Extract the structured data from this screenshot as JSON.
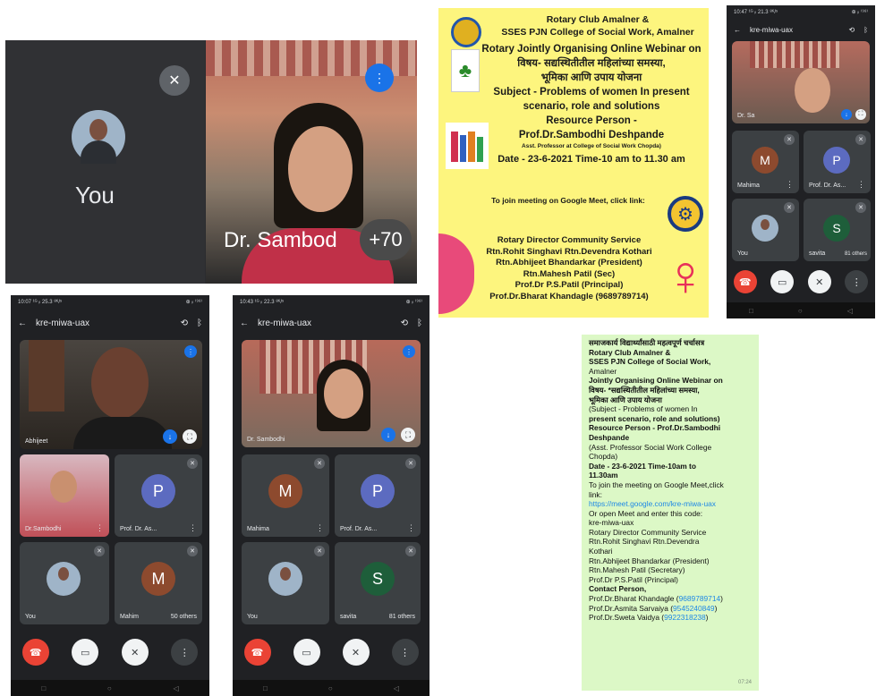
{
  "call_top_left": {
    "self_label": "You",
    "speaker_name": "Dr. Sambod",
    "others_count": "+70"
  },
  "poster": {
    "lines": [
      "Rotary Club Amalner &",
      "SSES PJN College of Social Work, Amalner",
      "Rotary  Jointly Organising Online Webinar on",
      "विषय- सद्यस्थितीतील महिलांच्या समस्या,",
      "भूमिका आणि उपाय योजना",
      "Subject - Problems of women In present",
      "scenario, role and solutions",
      "Resource Person -",
      "Prof.Dr.Sambodhi Deshpande"
    ],
    "subtitle": "Asst. Professor at College of Social Work Chopda)",
    "date_line": "Date - 23-6-2021  Time-10 am to 11.30 am",
    "join_line": "To join meeting on Google Meet, click link:",
    "directors": [
      "Rotary Director Community Service",
      "Rtn.Rohit Singhavi   Rtn.Devendra Kothari",
      "Rtn.Abhijeet Bhandarkar (President)",
      "Rtn.Mahesh Patil (Sec)",
      "Prof.Dr P.S.Patil (Principal)",
      "Prof.Dr.Bharat Khandagle (9689789714)"
    ]
  },
  "phone_right": {
    "status_time": "10:47 ¹ᴳ ᵢₗ 21.3 ⁸ᴷ/ˢ",
    "status_right": "⊕ ᵢₗ ⁽⁹⁸⁾",
    "meeting_code": "kre-miwa-uax",
    "featured_name": "Dr. Sa",
    "tiles": [
      {
        "name": "Mahima",
        "initial": "M",
        "color": "#8d4a2e"
      },
      {
        "name": "Prof. Dr. As...",
        "initial": "P",
        "color": "#5c6bc0"
      },
      {
        "name": "You"
      },
      {
        "name": "savita",
        "initial": "S",
        "color": "#1e5e3a",
        "extra": "81 others"
      }
    ]
  },
  "phone_a": {
    "status_time": "10:07 ¹ᴳ ᵢₗ 25.3 ⁸ᴷ/ˢ",
    "status_right": "⊕ ᵢₗ ⁽⁹⁸⁾",
    "meeting_code": "kre-miwa-uax",
    "featured_name": "Abhijeet",
    "tiles": [
      {
        "name": "Dr.Sambodhi"
      },
      {
        "name": "Prof. Dr. As...",
        "initial": "P",
        "color": "#5c6bc0"
      },
      {
        "name": "You"
      },
      {
        "name": "Mahim",
        "initial": "M",
        "color": "#8d4a2e",
        "extra": "50 others"
      }
    ]
  },
  "phone_b": {
    "status_time": "10:43 ¹ᴳ ᵢₗ 22.3 ⁸ᴷ/ˢ",
    "status_right": "⊕ ᵢₗ ⁽⁹⁸⁾",
    "meeting_code": "kre-miwa-uax",
    "featured_name": "Dr. Sambodhi",
    "tiles": [
      {
        "name": "Mahima",
        "initial": "M",
        "color": "#8d4a2e"
      },
      {
        "name": "Prof. Dr. As...",
        "initial": "P",
        "color": "#5c6bc0"
      },
      {
        "name": "You"
      },
      {
        "name": "savita",
        "initial": "S",
        "color": "#1e5e3a",
        "extra": "81 others"
      }
    ]
  },
  "chat": {
    "lines": [
      {
        "t": "समाजकार्य विद्यार्थ्यांसाठी महत्वपूर्ण चर्चासत्र",
        "b": true
      },
      {
        "t": "Rotary Club Amalner &",
        "b": true
      },
      {
        "t": "SSES PJN College of Social Work,",
        "b": true
      },
      {
        "t": "Amalner",
        "b": false
      },
      {
        "t": "Jointly Organising Online Webinar on",
        "b": true
      },
      {
        "t": "विषय- *सद्यस्थितीतील महिलांच्या समस्या,",
        "b": true
      },
      {
        "t": "भूमिका आणि उपाय योजना",
        "b": true
      },
      {
        "t": "(Subject - Problems of women In",
        "b": false,
        "mixed": "Problems of women In"
      },
      {
        "t": "present scenario, role and solutions)",
        "b": true
      },
      {
        "t": "Resource Person - Prof.Dr.Sambodhi",
        "b": true
      },
      {
        "t": "Deshpande",
        "b": true
      },
      {
        "t": "(Asst. Professor Social Work College",
        "b": false
      },
      {
        "t": "Chopda)",
        "b": false
      },
      {
        "t": "Date - 23-6-2021 Time-10am to",
        "b": true
      },
      {
        "t": "11.30am",
        "b": true
      },
      {
        "t": "To join the meeting on Google Meet,click",
        "b": false
      },
      {
        "t": "link:",
        "b": false
      },
      {
        "t": "https://meet.google.com/kre-miwa-uax",
        "b": false,
        "link": true
      },
      {
        "t": "Or open Meet and enter this code:",
        "b": false
      },
      {
        "t": "kre-miwa-uax",
        "b": false
      },
      {
        "t": "Rotary Director Community Service",
        "b": false
      },
      {
        "t": "Rtn.Rohit Singhavi    Rtn.Devendra",
        "b": false
      },
      {
        "t": "Kothari",
        "b": false
      },
      {
        "t": "Rtn.Abhijeet Bhandarkar (President)",
        "b": false
      },
      {
        "t": "Rtn.Mahesh Patil (Secretary)",
        "b": false
      },
      {
        "t": "Prof.Dr P.S.Patil (Principal)",
        "b": false
      },
      {
        "t": "Contact Person,",
        "b": true
      }
    ],
    "contacts": [
      {
        "name": "Prof.Dr.Bharat Khandagle (",
        "phone": "9689789714",
        "end": ")"
      },
      {
        "name": "Prof.Dr.Asmita Sarvaiya (",
        "phone": "9545240849",
        "end": ")"
      },
      {
        "name": "Prof.Dr.Sweta Vaidya  (",
        "phone": "9922318238",
        "end": ")"
      }
    ],
    "timestamp": "07:24"
  }
}
